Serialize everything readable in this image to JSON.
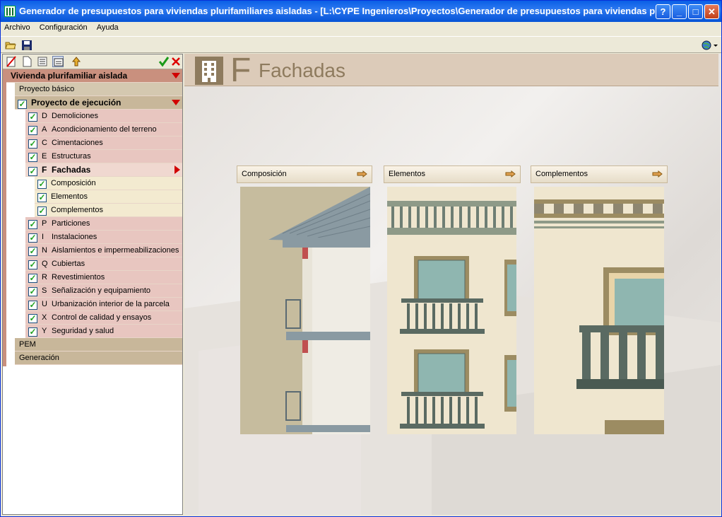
{
  "window": {
    "title": "Generador de presupuestos para viviendas plurifamiliares aisladas - [L:\\CYPE Ingenieros\\Proyectos\\Generador de presupuestos para viviendas plu"
  },
  "titlebar_buttons": {
    "help": "?",
    "minimize": "_",
    "maximize": "□",
    "close": "✕"
  },
  "menu": [
    "Archivo",
    "Configuración",
    "Ayuda"
  ],
  "tree": {
    "root": "Vivienda plurifamiliar aislada",
    "proyecto_basico": "Proyecto básico",
    "proyecto_ejecucion": "Proyecto de ejecución",
    "chapters_before": [
      {
        "letter": "D",
        "label": "Demoliciones"
      },
      {
        "letter": "A",
        "label": "Acondicionamiento del terreno"
      },
      {
        "letter": "C",
        "label": "Cimentaciones"
      },
      {
        "letter": "E",
        "label": "Estructuras"
      }
    ],
    "selected": {
      "letter": "F",
      "label": "Fachadas"
    },
    "subitems": [
      "Composición",
      "Elementos",
      "Complementos"
    ],
    "chapters_after": [
      {
        "letter": "P",
        "label": "Particiones"
      },
      {
        "letter": "I",
        "label": "Instalaciones"
      },
      {
        "letter": "N",
        "label": "Aislamientos e impermeabilizaciones"
      },
      {
        "letter": "Q",
        "label": "Cubiertas"
      },
      {
        "letter": "R",
        "label": "Revestimientos"
      },
      {
        "letter": "S",
        "label": "Señalización y equipamiento"
      },
      {
        "letter": "U",
        "label": "Urbanización interior de la parcela"
      },
      {
        "letter": "X",
        "label": "Control de calidad y ensayos"
      },
      {
        "letter": "Y",
        "label": "Seguridad y salud"
      }
    ],
    "pem": "PEM",
    "generacion": "Generación"
  },
  "header": {
    "letter": "F",
    "title": "Fachadas"
  },
  "cards": [
    {
      "label": "Composición"
    },
    {
      "label": "Elementos"
    },
    {
      "label": "Complementos"
    }
  ],
  "colors": {
    "accent": "#8e7b5e",
    "tree_root": "#c9907e",
    "chapter": "#e8c6c0",
    "check": "#21a121"
  }
}
